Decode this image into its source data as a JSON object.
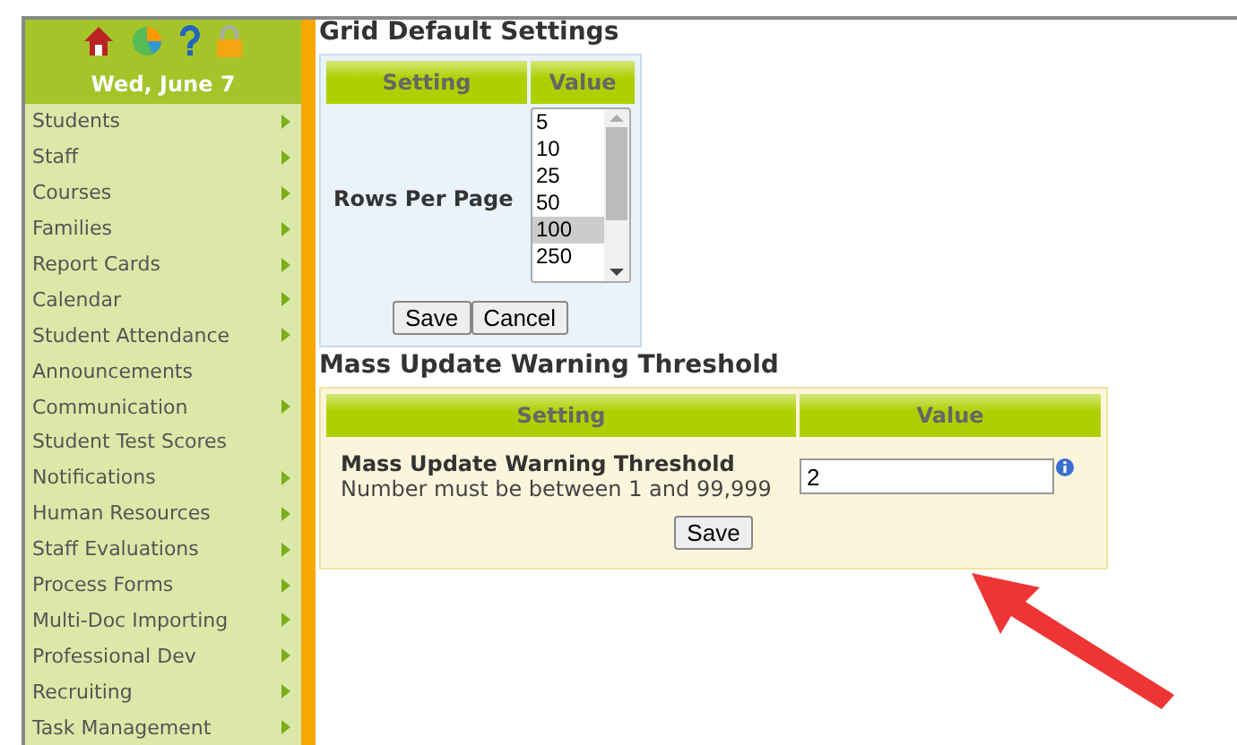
{
  "sidebar": {
    "date": "Wed, June 7",
    "items": [
      {
        "label": "Students",
        "has_submenu": true
      },
      {
        "label": "Staff",
        "has_submenu": true
      },
      {
        "label": "Courses",
        "has_submenu": true
      },
      {
        "label": "Families",
        "has_submenu": true
      },
      {
        "label": "Report Cards",
        "has_submenu": true
      },
      {
        "label": "Calendar",
        "has_submenu": true
      },
      {
        "label": "Student Attendance",
        "has_submenu": true
      },
      {
        "label": "Announcements",
        "has_submenu": false
      },
      {
        "label": "Communication",
        "has_submenu": true
      },
      {
        "label": "Student Test Scores",
        "has_submenu": false
      },
      {
        "label": "Notifications",
        "has_submenu": true
      },
      {
        "label": "Human Resources",
        "has_submenu": true
      },
      {
        "label": "Staff Evaluations",
        "has_submenu": true
      },
      {
        "label": "Process Forms",
        "has_submenu": true
      },
      {
        "label": "Multi-Doc Importing",
        "has_submenu": true
      },
      {
        "label": "Professional Dev",
        "has_submenu": true
      },
      {
        "label": "Recruiting",
        "has_submenu": true
      },
      {
        "label": "Task Management",
        "has_submenu": true
      }
    ]
  },
  "grid_settings": {
    "title": "Grid Default Settings",
    "columns": [
      "Setting",
      "Value"
    ],
    "row_label": "Rows Per Page",
    "options": [
      {
        "label": "5",
        "selected": false
      },
      {
        "label": "10",
        "selected": false
      },
      {
        "label": "25",
        "selected": false
      },
      {
        "label": "50",
        "selected": false
      },
      {
        "label": "100",
        "selected": true
      },
      {
        "label": "250",
        "selected": false
      }
    ],
    "buttons": [
      "Save",
      "Cancel"
    ]
  },
  "threshold": {
    "title": "Mass Update Warning Threshold",
    "columns": [
      "Setting",
      "Value"
    ],
    "label": "Mass Update Warning Threshold",
    "hint": "Number must be between 1 and 99,999",
    "value": "2",
    "button": "Save"
  }
}
